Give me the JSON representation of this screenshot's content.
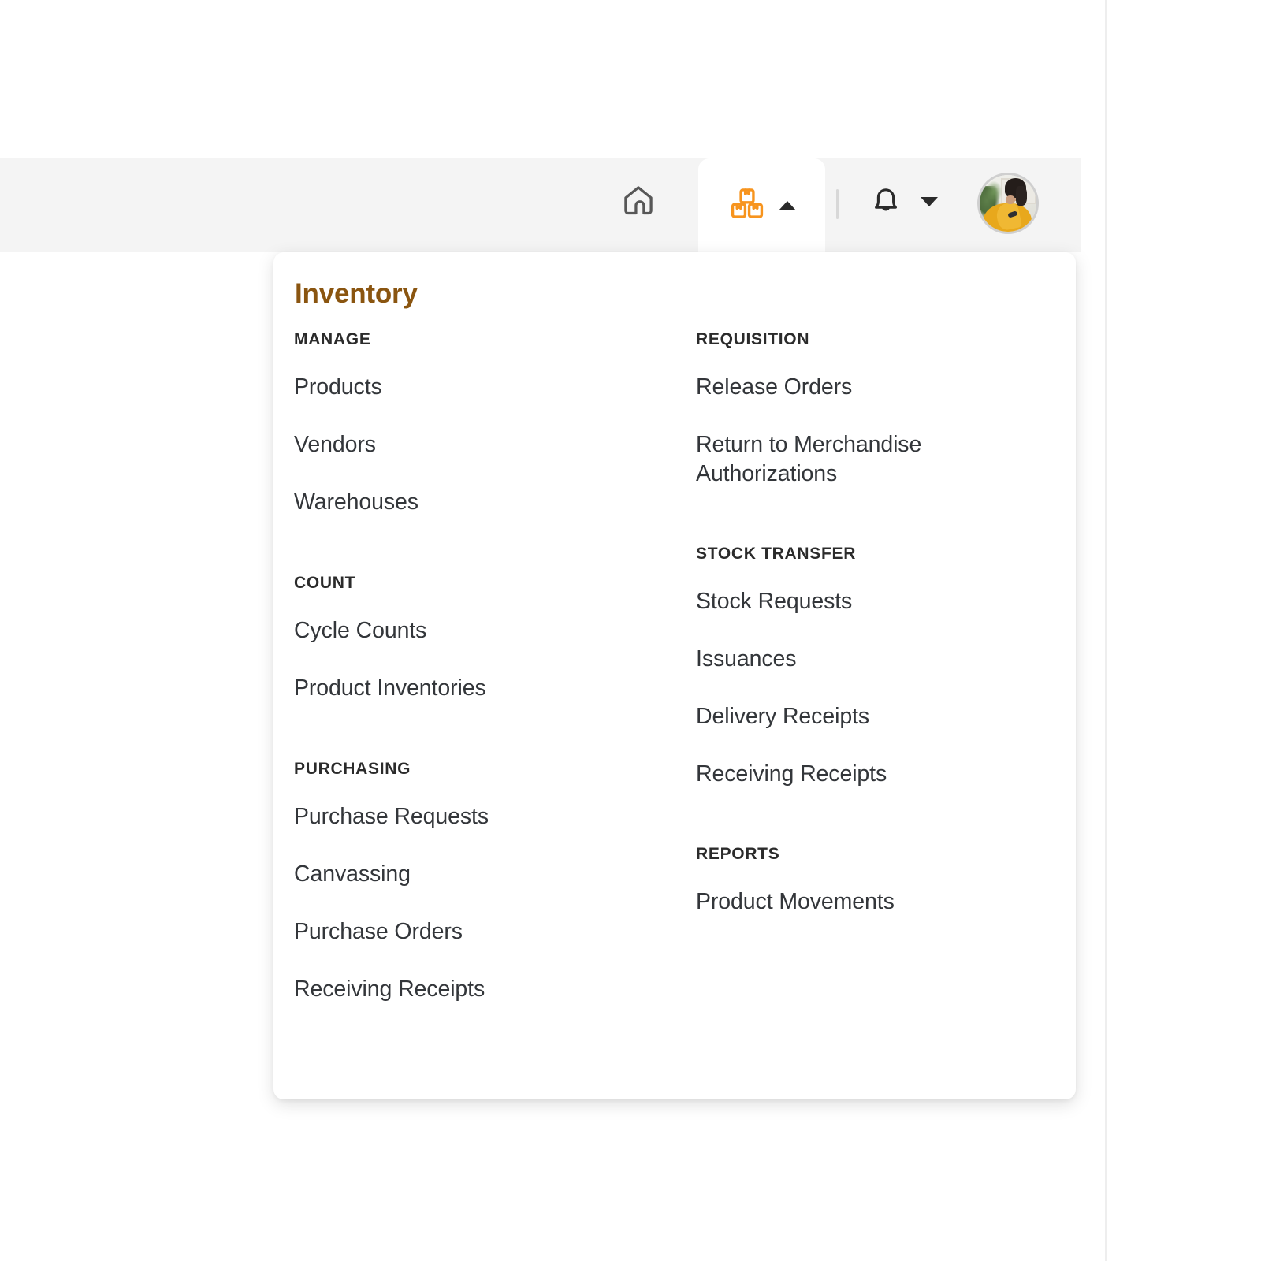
{
  "colors": {
    "brand_orange": "#F7941E",
    "title_brown": "#8A5510",
    "topbar_bg": "#F4F4F4",
    "panel_bg": "#FFFFFF",
    "text_dark": "#33363A",
    "heading_dark": "#2B2B2B",
    "divider": "#D8D8D8"
  },
  "topbar": {
    "home_label": "Home",
    "home_icon": "home-icon",
    "inventory_tab_label": "Inventory",
    "inventory_tab_icon": "boxes-icon",
    "inventory_tab_caret": "caret-up-icon",
    "inventory_tab_active": true,
    "divider_icon": "vertical-divider",
    "notifications_label": "Notifications",
    "notifications_icon": "bell-icon",
    "notifications_caret": "caret-down-icon",
    "avatar_label": "User avatar",
    "avatar_icon": "avatar-image"
  },
  "menu": {
    "title": "Inventory",
    "left_column": [
      {
        "heading": "MANAGE",
        "items": [
          "Products",
          "Vendors",
          "Warehouses"
        ]
      },
      {
        "heading": "COUNT",
        "items": [
          "Cycle Counts",
          "Product Inventories"
        ]
      },
      {
        "heading": "PURCHASING",
        "items": [
          "Purchase Requests",
          "Canvassing",
          "Purchase Orders",
          "Receiving Receipts"
        ]
      }
    ],
    "right_column": [
      {
        "heading": "REQUISITION",
        "items": [
          "Release Orders",
          "Return to Merchandise Authorizations"
        ]
      },
      {
        "heading": "STOCK TRANSFER",
        "items": [
          "Stock Requests",
          "Issuances",
          "Delivery Receipts",
          "Receiving Receipts"
        ]
      },
      {
        "heading": "REPORTS",
        "items": [
          "Product Movements"
        ]
      }
    ]
  }
}
